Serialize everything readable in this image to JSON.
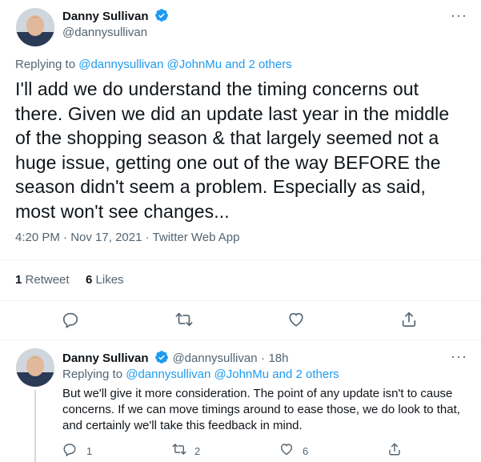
{
  "main_tweet": {
    "author_name": "Danny Sullivan",
    "author_handle": "@dannysullivan",
    "replying_to_label": "Replying to ",
    "replying_to_mentions": "@dannysullivan @JohnMu",
    "replying_to_and": " and ",
    "replying_to_others": "2 others",
    "text": "I'll add we do understand the timing concerns out there. Given we did an update last year in the middle of the shopping season & that largely seemed not a huge issue, getting one out of the way BEFORE the season didn't seem a problem. Especially as said, most won't see changes...",
    "time": "4:20 PM",
    "dot": "·",
    "date": "Nov 17, 2021",
    "source": "Twitter Web App",
    "retweet_count": "1",
    "retweet_label": "Retweet",
    "like_count": "6",
    "like_label": "Likes"
  },
  "reply_tweet": {
    "author_name": "Danny Sullivan",
    "author_handle": "@dannysullivan",
    "dot": "·",
    "age": "18h",
    "replying_to_label": "Replying to ",
    "replying_to_mentions": "@dannysullivan @JohnMu",
    "replying_to_and": " and ",
    "replying_to_others": "2 others",
    "text": "But we'll give it more consideration. The point of any update isn't to cause concerns. If we can move timings around to ease those, we do look to that, and certainly we'll take this feedback in mind.",
    "reply_count": "1",
    "retweet_count": "2",
    "like_count": "6"
  },
  "icons": {
    "verified": "verified-badge-icon",
    "more": "more-icon",
    "reply": "reply-icon",
    "retweet": "retweet-icon",
    "like": "heart-icon",
    "share": "share-icon"
  },
  "colors": {
    "accent": "#1d9bf0",
    "secondary_text": "#536471",
    "divider": "#eff3f4"
  },
  "more_glyph": "···"
}
